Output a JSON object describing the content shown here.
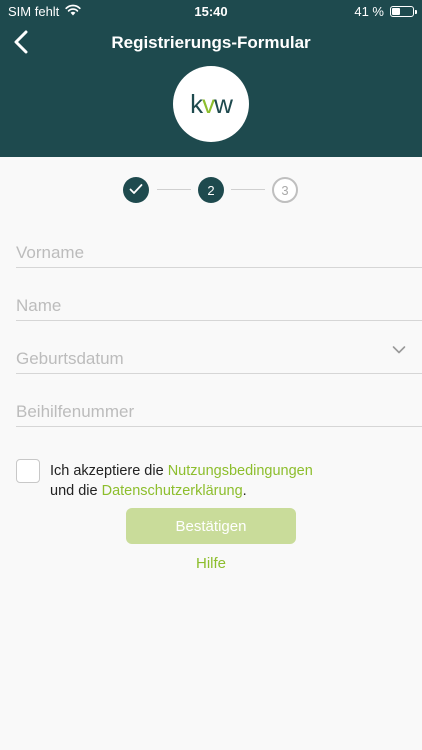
{
  "status_bar": {
    "carrier": "SIM fehlt",
    "time": "15:40",
    "battery": "41 %",
    "battery_level": 0.41
  },
  "header": {
    "title": "Registrierungs-Formular",
    "back_icon": "chevron-left-icon",
    "logo": {
      "k": "k",
      "v": "v",
      "w": "w"
    }
  },
  "stepper": {
    "steps": [
      {
        "state": "done",
        "icon": "checkmark-icon"
      },
      {
        "label": "2",
        "state": "active"
      },
      {
        "label": "3",
        "state": "todo"
      }
    ]
  },
  "form": {
    "first_name_placeholder": "Vorname",
    "last_name_placeholder": "Name",
    "birthdate_placeholder": "Geburtsdatum",
    "aid_number_placeholder": "Beihilfenummer"
  },
  "terms": {
    "prefix": "Ich akzeptiere die ",
    "terms_link": "Nutzungsbedingungen",
    "middle": "und die ",
    "privacy_link": "Datenschutzerklärung",
    "suffix": "."
  },
  "actions": {
    "confirm_label": "Bestätigen",
    "help_label": "Hilfe"
  },
  "colors": {
    "header_bg": "#1e4a4e",
    "accent": "#8dbe2d",
    "confirm_disabled": "#c9dc9a"
  }
}
